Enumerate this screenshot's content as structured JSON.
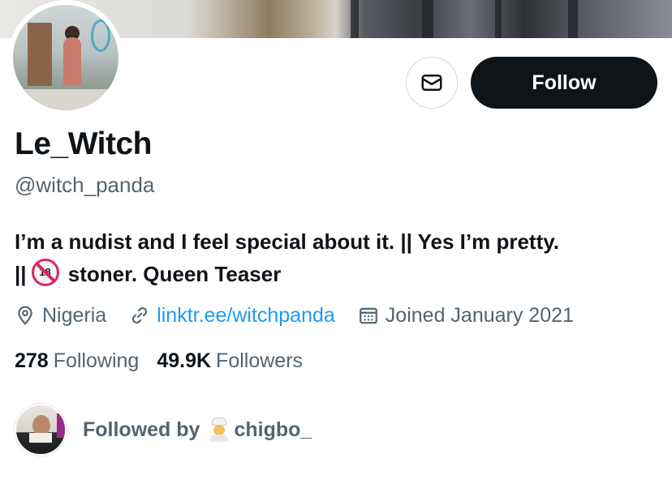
{
  "profile": {
    "display_name": "Le_Witch",
    "handle": "@witch_panda",
    "bio_line1": "I’m a nudist and I feel special about it. || Yes I’m pretty.",
    "bio_line2_prefix": "||",
    "bio_emoji_text": "18",
    "bio_line2_suffix": "stoner. Queen Teaser",
    "location": "Nigeria",
    "website": "linktr.ee/witchpanda",
    "joined": "Joined January 2021"
  },
  "actions": {
    "follow_label": "Follow",
    "message_icon": "envelope-icon"
  },
  "stats": {
    "following_count": "278",
    "following_label": "Following",
    "followers_count": "49.9K",
    "followers_label": "Followers"
  },
  "followed_by": {
    "label": "Followed by",
    "user": "chigbo_",
    "user_emoji": "chef-emoji"
  },
  "colors": {
    "text_primary": "#0f1419",
    "text_secondary": "#536471",
    "link": "#1d9bf0",
    "button_dark": "#0f1419",
    "border": "#cfd9de"
  }
}
